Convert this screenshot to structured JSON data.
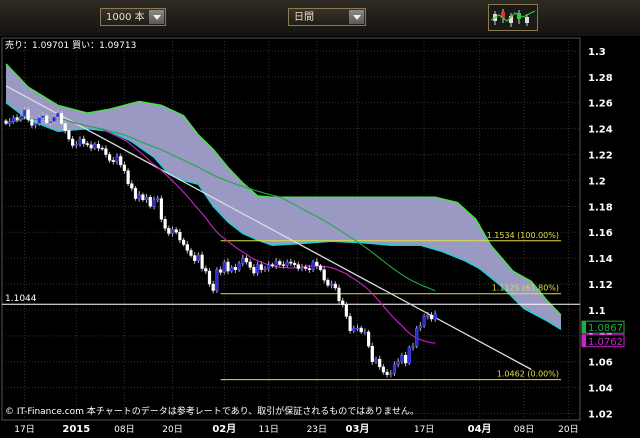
{
  "toolbar": {
    "count_select": "1000 本",
    "period_select": "日間",
    "chart_tool_icon": "candlestick-indicator-icon"
  },
  "chart_data": {
    "type": "candlestick",
    "price_readout": "売り：1.09701 買い：1.09713",
    "y_ticks": [
      "1.3",
      "1.28",
      "1.26",
      "1.24",
      "1.22",
      "1.2",
      "1.18",
      "1.16",
      "1.14",
      "1.12",
      "1.1",
      "1.08",
      "1.06",
      "1.04",
      "1.02"
    ],
    "ylim": [
      1.015,
      1.31
    ],
    "x_ticks": [
      "17日",
      "2015",
      "08日",
      "20日",
      "02月",
      "11日",
      "23日",
      "03月",
      "17日",
      "04月",
      "08日",
      "20日"
    ],
    "x_tick_bold": [
      false,
      true,
      false,
      false,
      true,
      false,
      false,
      true,
      false,
      true,
      false,
      false
    ],
    "x_tick_index": [
      5,
      19,
      32,
      45,
      59,
      71,
      84,
      95,
      113,
      128,
      140,
      152
    ],
    "n_bars": 128,
    "closes": [
      1.244,
      1.2455,
      1.2485,
      1.247,
      1.2495,
      1.2545,
      1.247,
      1.2425,
      1.244,
      1.2485,
      1.25,
      1.2445,
      1.2455,
      1.249,
      1.252,
      1.244,
      1.2385,
      1.232,
      1.227,
      1.228,
      1.232,
      1.2285,
      1.2275,
      1.225,
      1.228,
      1.225,
      1.2245,
      1.22,
      1.2155,
      1.2145,
      1.2185,
      1.212,
      1.2075,
      1.1975,
      1.194,
      1.186,
      1.189,
      1.185,
      1.187,
      1.18,
      1.185,
      1.186,
      1.17,
      1.163,
      1.159,
      1.162,
      1.16,
      1.154,
      1.1505,
      1.146,
      1.142,
      1.138,
      1.1425,
      1.132,
      1.13,
      1.12,
      1.115,
      1.131,
      1.129,
      1.137,
      1.13,
      1.133,
      1.131,
      1.136,
      1.14,
      1.137,
      1.133,
      1.1285,
      1.135,
      1.131,
      1.132,
      1.135,
      1.134,
      1.1375,
      1.135,
      1.1345,
      1.137,
      1.136,
      1.135,
      1.132,
      1.133,
      1.132,
      1.131,
      1.137,
      1.134,
      1.131,
      1.123,
      1.119,
      1.12,
      1.117,
      1.107,
      1.104,
      1.095,
      1.084,
      1.086,
      1.086,
      1.083,
      1.083,
      1.072,
      1.06,
      1.062,
      1.056,
      1.052,
      1.05,
      1.051,
      1.058,
      1.06,
      1.065,
      1.059,
      1.071,
      1.072,
      1.086,
      1.088,
      1.095,
      1.096,
      1.093,
      1.097
    ],
    "moving_averages": [
      {
        "period": 25,
        "color": "#cc22cc",
        "last": "1.0762"
      },
      {
        "period": 75,
        "color": "#22aa44",
        "last": "1.0867"
      }
    ],
    "cloud_upper": [
      [
        0,
        1.29
      ],
      [
        6,
        1.272
      ],
      [
        14,
        1.258
      ],
      [
        22,
        1.252
      ],
      [
        28,
        1.255
      ],
      [
        36,
        1.261
      ],
      [
        42,
        1.258
      ],
      [
        48,
        1.25
      ],
      [
        52,
        1.235
      ],
      [
        56,
        1.224
      ],
      [
        60,
        1.21
      ],
      [
        64,
        1.198
      ],
      [
        68,
        1.188
      ],
      [
        72,
        1.187
      ],
      [
        80,
        1.187
      ],
      [
        92,
        1.187
      ],
      [
        104,
        1.187
      ],
      [
        112,
        1.187
      ],
      [
        116,
        1.187
      ],
      [
        122,
        1.183
      ],
      [
        127,
        1.17
      ],
      [
        131,
        1.15
      ],
      [
        137,
        1.13
      ],
      [
        142,
        1.122
      ],
      [
        146,
        1.108
      ],
      [
        150,
        1.096
      ]
    ],
    "cloud_lower": [
      [
        0,
        1.26
      ],
      [
        6,
        1.247
      ],
      [
        14,
        1.238
      ],
      [
        22,
        1.24
      ],
      [
        28,
        1.238
      ],
      [
        34,
        1.23
      ],
      [
        40,
        1.218
      ],
      [
        44,
        1.205
      ],
      [
        48,
        1.2
      ],
      [
        52,
        1.197
      ],
      [
        56,
        1.18
      ],
      [
        60,
        1.168
      ],
      [
        64,
        1.159
      ],
      [
        68,
        1.154
      ],
      [
        72,
        1.15
      ],
      [
        78,
        1.151
      ],
      [
        88,
        1.153
      ],
      [
        96,
        1.152
      ],
      [
        104,
        1.15
      ],
      [
        112,
        1.15
      ],
      [
        118,
        1.145
      ],
      [
        124,
        1.138
      ],
      [
        128,
        1.132
      ],
      [
        134,
        1.118
      ],
      [
        140,
        1.101
      ],
      [
        146,
        1.092
      ],
      [
        150,
        1.085
      ]
    ],
    "trendline": [
      [
        0,
        1.273
      ],
      [
        142,
        1.054
      ]
    ],
    "trendline_label": "",
    "hline": {
      "value": 1.1044,
      "label": "1.1044"
    },
    "fib": {
      "x_range": [
        58,
        150
      ],
      "levels": [
        {
          "value": 1.1534,
          "label": "1.1534 (100.00%)"
        },
        {
          "value": 1.1125,
          "label": "1.1125 (61.80%)"
        },
        {
          "value": 1.0462,
          "label": "1.0462 (0.00%)"
        }
      ]
    },
    "price_tags": [
      {
        "value": 1.0867,
        "label": "1.0867",
        "color": "#22aa44"
      },
      {
        "value": 1.0762,
        "label": "1.0762",
        "color": "#cc22cc"
      }
    ],
    "copyright": "© IT-Finance.com 本チャートのデータは参考レートであり、取引が保証されるものではありません。"
  },
  "colors": {
    "bull": "#2b2bd6",
    "bear": "#ffffff",
    "cloud_top": "#4ce04c",
    "cloud_bottom": "#22cccc",
    "cloud_fill": "#b4b4e6",
    "fib": "#e0e040"
  }
}
